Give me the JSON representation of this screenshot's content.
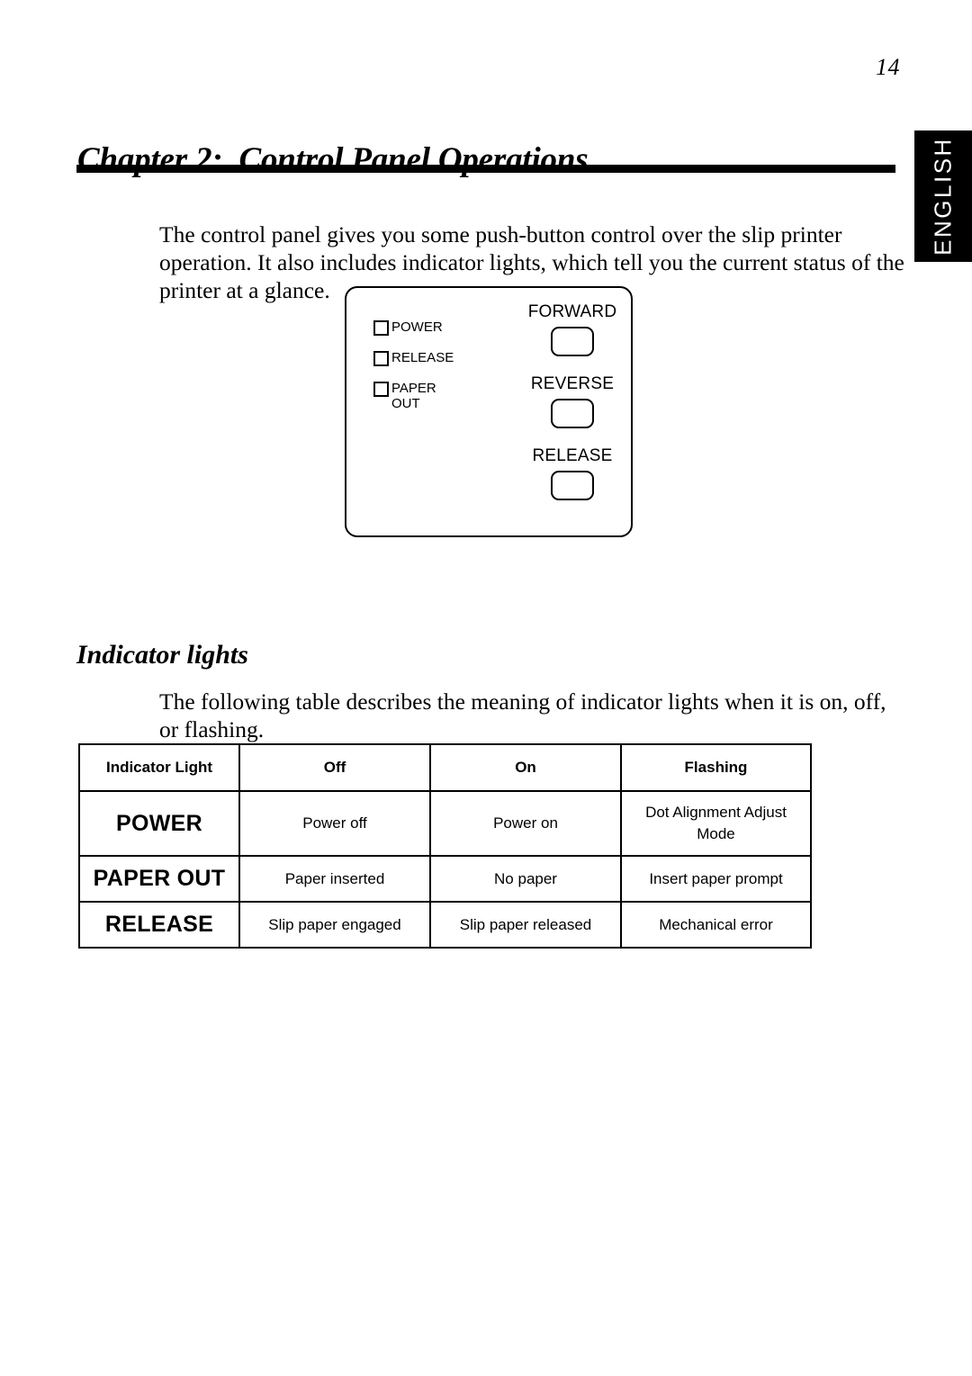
{
  "page": {
    "number": "14"
  },
  "side_tab": {
    "label": "ENGLISH",
    "background": "#000000",
    "text_color": "#ffffff"
  },
  "chapter": {
    "title": "Chapter 2:  Control Panel Operations",
    "intro": "The control panel gives you some push-button control over the slip printer operation. It also includes indicator lights, which tell you the current status of the printer at a glance."
  },
  "control_panel": {
    "indicators": [
      {
        "label": "POWER"
      },
      {
        "label": "RELEASE"
      },
      {
        "label": "PAPER\nOUT"
      }
    ],
    "buttons": [
      {
        "label": "FORWARD"
      },
      {
        "label": "REVERSE"
      },
      {
        "label": "RELEASE"
      }
    ]
  },
  "section": {
    "heading": "Indicator lights",
    "paragraph": "The following table describes the meaning of indicator lights when it is on, off, or flashing."
  },
  "table": {
    "headers": [
      "Indicator Light",
      "Off",
      "On",
      "Flashing"
    ],
    "rows": [
      {
        "label": "POWER",
        "off": "Power off",
        "on": "Power on",
        "flashing": "Dot Alignment Adjust Mode"
      },
      {
        "label": "PAPER OUT",
        "off": "Paper inserted",
        "on": "No paper",
        "flashing": "Insert paper prompt"
      },
      {
        "label": "RELEASE",
        "off": "Slip paper engaged",
        "on": "Slip paper released",
        "flashing": "Mechanical error"
      }
    ]
  }
}
